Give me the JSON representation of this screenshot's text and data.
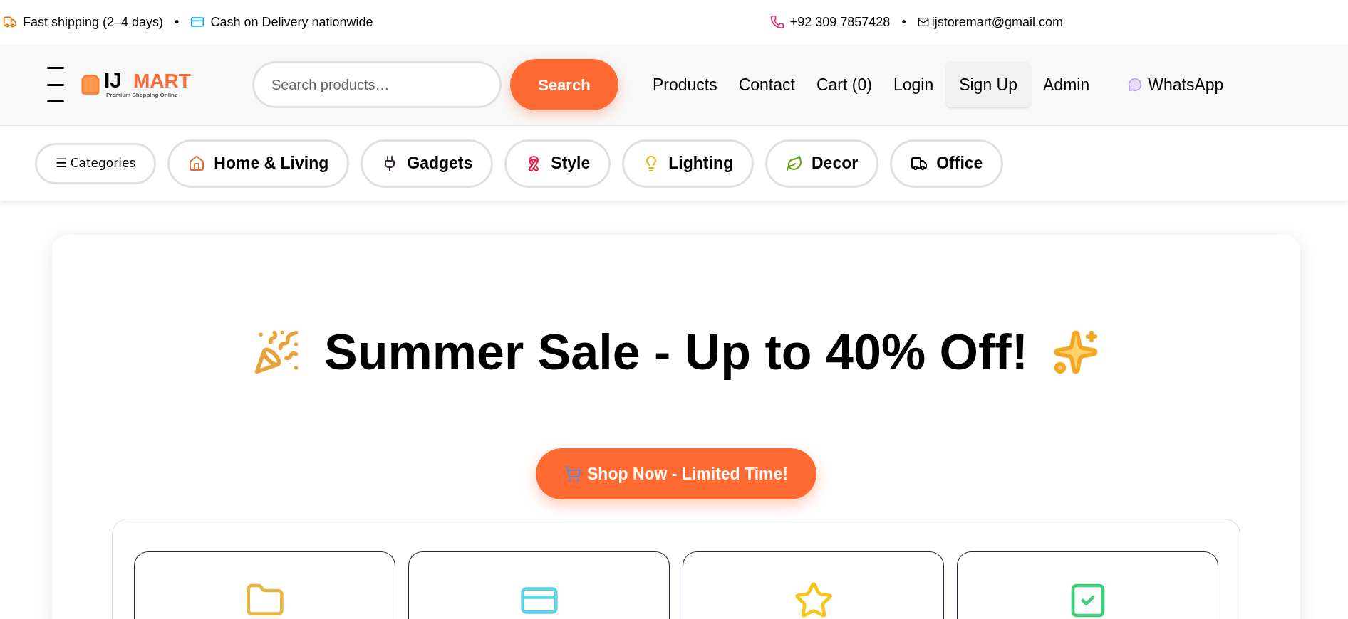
{
  "top_bar": {
    "left": [
      "Fast shipping (2–4 days)",
      "Cash on Delivery nationwide"
    ],
    "right": [
      "+92 309 7857428",
      "ijstoremart@gmail.com"
    ],
    "separator": "•"
  },
  "header": {
    "logo": {
      "brand": "IJ",
      "accent": "MART",
      "tagline": "Premium Shopping Online"
    },
    "search": {
      "placeholder": "Search products…",
      "button": "Search"
    },
    "nav": [
      {
        "label": "Products",
        "kind": "link"
      },
      {
        "label": "Contact",
        "kind": "link"
      },
      {
        "label": "Cart (0)",
        "kind": "link"
      },
      {
        "label": "Login",
        "kind": "link"
      },
      {
        "label": "Sign Up",
        "kind": "button"
      },
      {
        "label": "Admin",
        "kind": "link"
      },
      {
        "label": "WhatsApp",
        "kind": "chat"
      }
    ]
  },
  "categories": [
    {
      "label": "☰ Categories",
      "kind": "menu"
    },
    {
      "label": "Home & Living",
      "kind": "home"
    },
    {
      "label": "Gadgets",
      "kind": "plug"
    },
    {
      "label": "Style",
      "kind": "ribbon"
    },
    {
      "label": "Lighting",
      "kind": "bulb"
    },
    {
      "label": "Decor",
      "kind": "leaf"
    },
    {
      "label": "Office",
      "kind": "truck"
    }
  ],
  "hero": {
    "title": "Summer Sale - Up to 40% Off!",
    "button": "Shop Now - Limited Time!",
    "features": [
      {
        "kind": "folder"
      },
      {
        "kind": "card"
      },
      {
        "kind": "star"
      },
      {
        "kind": "check"
      }
    ]
  }
}
